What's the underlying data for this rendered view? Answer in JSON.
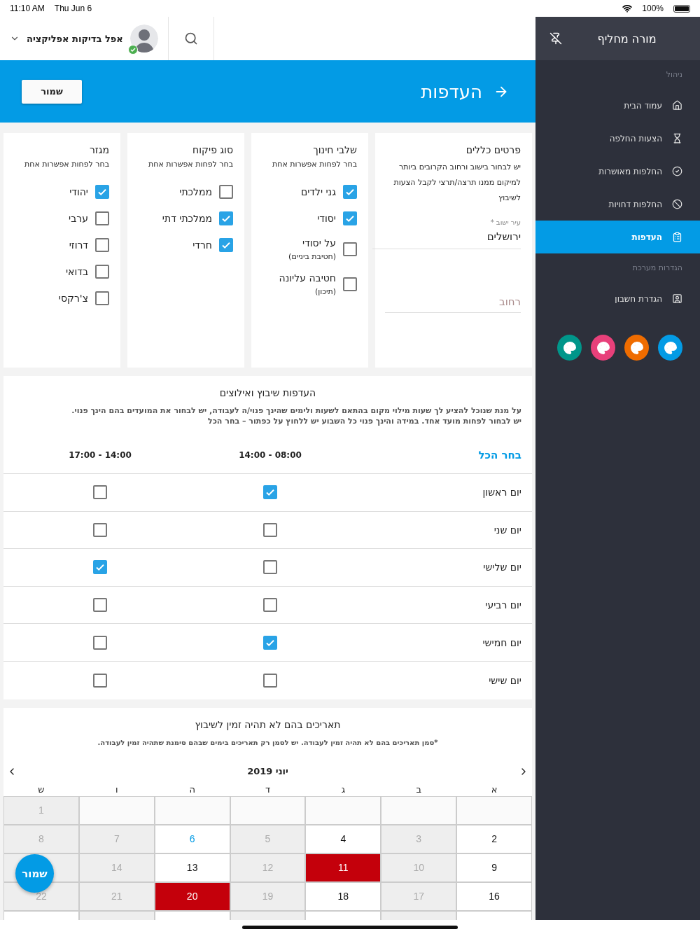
{
  "status_bar": {
    "time": "11:10 AM",
    "date": "Thu Jun 6",
    "battery": "100%"
  },
  "header": {
    "user_name": "אפל בדיקות אפליקציה"
  },
  "banner": {
    "title": "העדפות",
    "save_button": "שמור"
  },
  "cards": [
    {
      "kind": "form",
      "title": "פרטים כללים",
      "description": "יש לבחור בישוב ורחוב הקרובים ביותר למיקום ממנו תרצה/תרצי לקבל הצעות לשיבוץ",
      "fields": [
        {
          "label": "עיר ישוב *",
          "value": "ירושלים"
        },
        {
          "placeholder": "רחוב"
        }
      ]
    },
    {
      "kind": "checklist",
      "title": "שלבי חינוך",
      "subtitle": "בחר לפחות אפשרות אחת",
      "options": [
        {
          "label": "גני ילדים",
          "checked": true
        },
        {
          "label": "יסודי",
          "checked": true
        },
        {
          "label": "על יסודי",
          "sublabel": "(חטיבת ביניים)",
          "checked": false
        },
        {
          "label": "חטיבה עליונה",
          "sublabel": "(תיכון)",
          "checked": false
        }
      ]
    },
    {
      "kind": "checklist",
      "title": "סוג פיקוח",
      "subtitle": "בחר לפחות אפשרות אחת",
      "options": [
        {
          "label": "ממלכתי",
          "checked": false
        },
        {
          "label": "ממלכתי דתי",
          "checked": true
        },
        {
          "label": "חרדי",
          "checked": true
        }
      ]
    },
    {
      "kind": "checklist",
      "title": "מגזר",
      "subtitle": "בחר לפחות אפשרות אחת",
      "options": [
        {
          "label": "יהודי",
          "checked": true
        },
        {
          "label": "ערבי",
          "checked": false
        },
        {
          "label": "דרוזי",
          "checked": false
        },
        {
          "label": "בדואי",
          "checked": false
        },
        {
          "label": "צ'רקסי",
          "checked": false
        }
      ]
    }
  ],
  "schedule": {
    "title": "העדפות שיבוץ ואילוצים",
    "description": [
      "על מנת שנוכל להציע לך שעות מילוי מקום בהתאם לשעות ולימים שהינך פנוי/ה לעבודה, יש לבחור את המועדים בהם הינך פנוי.",
      "יש לבחור לפחות מועד אחד. במידה והינך פנוי כל השבוע יש ללחוץ על כפתור – בחר הכל"
    ],
    "select_all": "בחר הכל",
    "columns": [
      "14:00 - 08:00",
      "17:00 - 14:00"
    ],
    "rows": [
      {
        "day": "יום ראשון",
        "slots": [
          {
            "checked": true
          },
          {
            "checked": false
          }
        ]
      },
      {
        "day": "יום שני",
        "slots": [
          {
            "checked": false
          },
          {
            "checked": false
          }
        ]
      },
      {
        "day": "יום שלישי",
        "slots": [
          {
            "checked": false
          },
          {
            "checked": true
          }
        ]
      },
      {
        "day": "יום רביעי",
        "slots": [
          {
            "checked": false
          },
          {
            "checked": false
          }
        ]
      },
      {
        "day": "יום חמישי",
        "slots": [
          {
            "checked": true
          },
          {
            "checked": false
          }
        ]
      },
      {
        "day": "יום שישי",
        "slots": [
          {
            "checked": false
          },
          {
            "checked": false
          }
        ]
      }
    ]
  },
  "blocked_dates": {
    "title": "תאריכים בהם לא תהיה זמין לשיבוץ",
    "note": "*סמן תאריכים בהם לא תהיה זמין לעבודה. יש לסמן רק תאריכים בימים שבהם סימנת שתהיה זמין לעבודה.",
    "month": "יוני 2019",
    "weekdays": [
      "א",
      "ב",
      "ג",
      "ד",
      "ה",
      "ו",
      "ש"
    ],
    "weeks": [
      [
        {
          "kind": "empty"
        },
        {
          "kind": "empty"
        },
        {
          "kind": "empty"
        },
        {
          "kind": "empty"
        },
        {
          "kind": "empty"
        },
        {
          "kind": "empty"
        },
        {
          "day": "1",
          "kind": "disabled"
        }
      ],
      [
        {
          "day": "2",
          "kind": "available"
        },
        {
          "day": "3",
          "kind": "disabled"
        },
        {
          "day": "4",
          "kind": "available"
        },
        {
          "day": "5",
          "kind": "disabled"
        },
        {
          "day": "6",
          "kind": "today"
        },
        {
          "day": "7",
          "kind": "disabled"
        },
        {
          "day": "8",
          "kind": "disabled"
        }
      ],
      [
        {
          "day": "9",
          "kind": "available"
        },
        {
          "day": "10",
          "kind": "disabled"
        },
        {
          "day": "11",
          "kind": "blocked"
        },
        {
          "day": "12",
          "kind": "disabled"
        },
        {
          "day": "13",
          "kind": "available"
        },
        {
          "day": "14",
          "kind": "disabled"
        },
        {
          "kind": "covered"
        }
      ],
      [
        {
          "day": "16",
          "kind": "available"
        },
        {
          "day": "17",
          "kind": "disabled"
        },
        {
          "day": "18",
          "kind": "available"
        },
        {
          "day": "19",
          "kind": "disabled"
        },
        {
          "day": "20",
          "kind": "blocked"
        },
        {
          "day": "21",
          "kind": "disabled"
        },
        {
          "day": "22",
          "kind": "disabled"
        }
      ]
    ]
  },
  "fab": "שמור",
  "sidebar": {
    "title": "מורה מחליף",
    "sections": [
      {
        "heading": "ניהול",
        "items": [
          {
            "label": "עמוד הבית",
            "selected": false
          },
          {
            "label": "הצעות החלפה",
            "selected": false
          },
          {
            "label": "החלפות מאושרות",
            "selected": false
          },
          {
            "label": "החלפות דחויות",
            "selected": false
          },
          {
            "label": "העדפות",
            "selected": true
          }
        ]
      },
      {
        "heading": "הגדרות מערכת",
        "items": [
          {
            "label": "הגדרת חשבון",
            "selected": false
          }
        ]
      }
    ],
    "themes": [
      {
        "color": "#039be5"
      },
      {
        "color": "#ef6c00"
      },
      {
        "color": "#e8407a"
      },
      {
        "color": "#00968a"
      }
    ]
  }
}
